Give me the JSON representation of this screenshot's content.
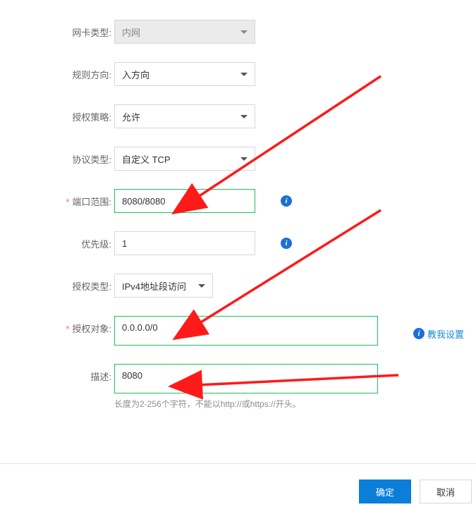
{
  "rows": {
    "nic_type": {
      "label": "网卡类型:",
      "value": "内网"
    },
    "direction": {
      "label": "规则方向:",
      "value": "入方向"
    },
    "policy": {
      "label": "授权策略:",
      "value": "允许"
    },
    "protocol": {
      "label": "协议类型:",
      "value": "自定义 TCP"
    },
    "port_range": {
      "label": "端口范围:",
      "value": "8080/8080"
    },
    "priority": {
      "label": "优先级:",
      "value": "1"
    },
    "auth_type": {
      "label": "授权类型:",
      "value": "IPv4地址段访问"
    },
    "auth_obj": {
      "label": "授权对象:",
      "value": "0.0.0.0/0",
      "teach": "教我设置"
    },
    "desc": {
      "label": "描述:",
      "value": "8080",
      "hint": "长度为2-256个字符，不能以http://或https://开头。"
    }
  },
  "required_mark": "*",
  "footer": {
    "ok": "确定",
    "cancel": "取消"
  },
  "icons": {
    "info_glyph": "i"
  }
}
